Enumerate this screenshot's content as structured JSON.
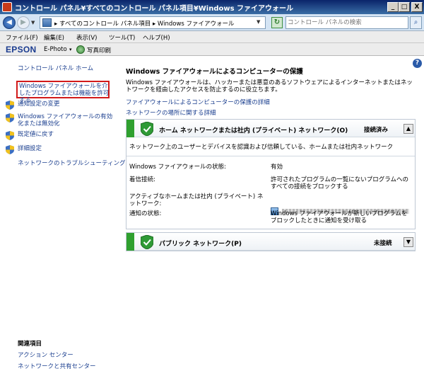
{
  "window": {
    "title": "コントロール パネル¥すべてのコントロール パネル項目¥Windows ファイアウォール",
    "min": "_",
    "max": "□",
    "close": "X"
  },
  "address": {
    "back": "◀",
    "forward": "▶",
    "dropdown": "▼",
    "breadcrumb": "▸ すべてのコントロール パネル項目 ▸ Windows ファイアウォール",
    "refresh": "↻",
    "search_placeholder": "コントロール パネルの検索"
  },
  "menu": [
    "ファイル(F)",
    "編集(E)",
    "表示(V)",
    "ツール(T)",
    "ヘルプ(H)"
  ],
  "toolbar": {
    "brand": "EPSON",
    "ephoto": "E-Photo",
    "dropdown": "▾",
    "photo_print": "写真印刷"
  },
  "sidebar": {
    "home": "コントロール パネル ホーム",
    "allow_program": "Windows ファイアウォールを介したプログラムまたは機能を許可する",
    "items": [
      "通知設定の変更",
      "Windows ファイアウォールの有効化または無効化",
      "既定値に戻す",
      "詳細設定"
    ],
    "troubleshoot": "ネットワークのトラブルシューティング",
    "related_title": "関連項目",
    "related": [
      "アクション センター",
      "ネットワークと共有センター"
    ]
  },
  "main": {
    "help": "?",
    "title": "Windows ファイアウォールによるコンピューターの保護",
    "description": "Windows ファイアウォールは、ハッカーまたは悪意のあるソフトウェアによるインターネットまたはネットワークを経由したアクセスを防止するのに役立ちます。",
    "link_details": "ファイアウォールによるコンピューターの保護の詳細",
    "link_locations": "ネットワークの場所に関する詳細",
    "home_network": {
      "name": "ホーム ネットワークまたは社内 (プライベート) ネットワーク(O)",
      "status": "接続済み",
      "toggle": "▲",
      "description": "ネットワーク上のユーザーとデバイスを認識および信頼している、ホームまたは社内ネットワーク",
      "rows": [
        {
          "label": "Windows ファイアウォールの状態:",
          "value": "有効"
        },
        {
          "label": "着信接続:",
          "value": "許可されたプログラムの一覧にないプログラムへのすべての接続をブロックする"
        },
        {
          "label": "アクティブなホームまたは社内 (プライベート) ネットワーク:",
          "value": ""
        },
        {
          "label": "通知の状態:",
          "value": "Windows ファイアウォールが新しいプログラムをブロックしたときに通知を受け取る"
        }
      ]
    },
    "public_network": {
      "name": "パブリック ネットワーク(P)",
      "status": "未接続",
      "toggle": "▼"
    }
  }
}
